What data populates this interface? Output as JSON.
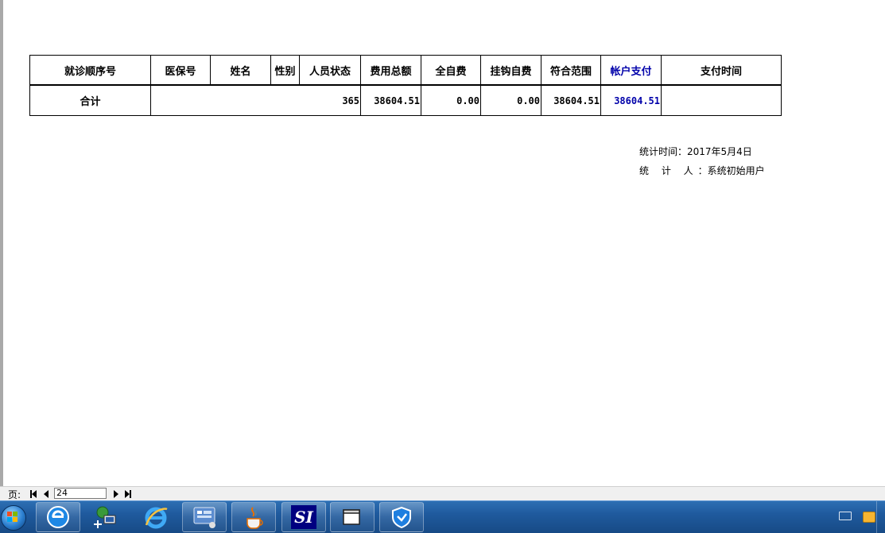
{
  "report": {
    "headers": [
      "就诊顺序号",
      "医保号",
      "姓名",
      "性别",
      "人员状态",
      "费用总额",
      "全自费",
      "挂钩自费",
      "符合范围",
      "帐户支付",
      "支付时间"
    ],
    "total_row": {
      "label": "合计",
      "count": "365",
      "total_fee": "38604.51",
      "self_pay": "0.00",
      "linked_self_pay": "0.00",
      "within_scope": "38604.51",
      "account_pay": "38604.51",
      "pay_time": ""
    }
  },
  "footer": {
    "stat_time": "统计时间：2017年5月4日",
    "stat_person_label": "统 计 人",
    "stat_person_value": "：系统初始用户"
  },
  "pager": {
    "page_label": "页:",
    "page_value": "24"
  },
  "taskbar": {
    "apps": [
      "start-orb",
      "ie-icon",
      "network-icon",
      "ie-edge-icon",
      "control-panel-icon",
      "java-icon",
      "si-app",
      "window-app",
      "shield-app"
    ],
    "si_label": "SI"
  },
  "colors": {
    "header_blue": "#0000aa",
    "taskbar": "#1f5a9e"
  }
}
